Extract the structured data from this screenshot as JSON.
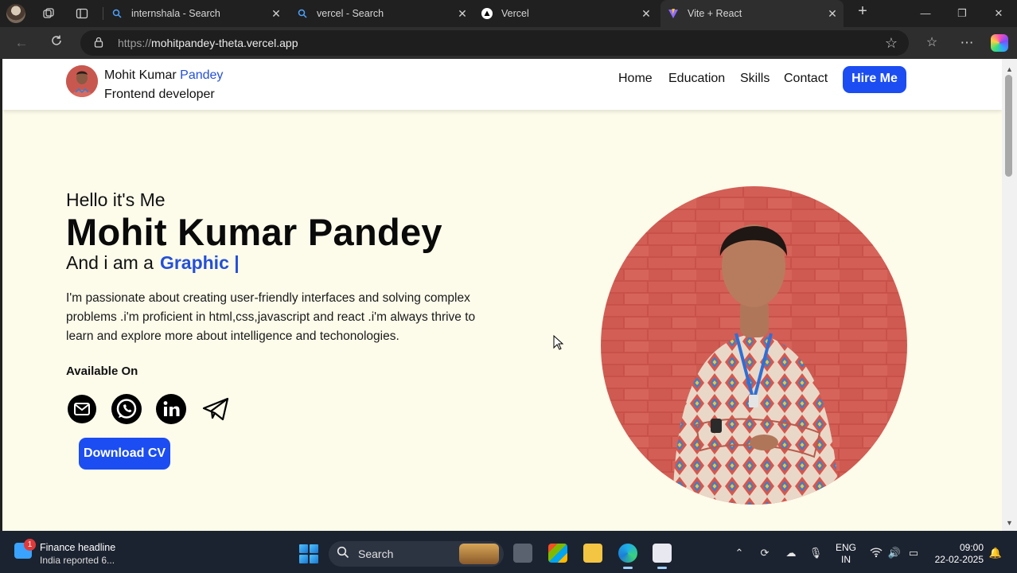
{
  "browser": {
    "tabs": [
      {
        "label": "internshala - Search",
        "icon": "search-icon"
      },
      {
        "label": "vercel - Search",
        "icon": "search-icon"
      },
      {
        "label": "Vercel",
        "icon": "vercel-logo-icon"
      },
      {
        "label": "Vite + React",
        "icon": "vite-logo-icon",
        "active": true
      }
    ],
    "url_prefix": "https://",
    "url_host": "mohitpandey-theta.vercel.app"
  },
  "site": {
    "brand_first": "Mohit Kumar",
    "brand_last": "Pandey",
    "brand_role": "Frontend developer",
    "nav": [
      "Home",
      "Education",
      "Skills",
      "Contact"
    ],
    "hire_label": "Hire Me",
    "accent_color": "#1b4df2"
  },
  "hero": {
    "greeting": "Hello it's Me",
    "name": "Mohit Kumar Pandey",
    "role_prefix": "And i am a",
    "role_typed": "Graphic |",
    "about": "I'm passionate about creating user-friendly interfaces and solving complex problems .i'm proficient in html,css,javascript and react .i'm always thrive to learn and explore more about intelligence and techonologies.",
    "available_label": "Available On",
    "socials": [
      "email-icon",
      "whatsapp-icon",
      "linkedin-icon",
      "telegram-icon"
    ],
    "download_label": "Download CV"
  },
  "taskbar": {
    "news_badge": "1",
    "news_title": "Finance headline",
    "news_sub": "India reported 6...",
    "search_label": "Search",
    "lang_top": "ENG",
    "lang_bottom": "IN",
    "time": "09:00",
    "date": "22-02-2025"
  }
}
